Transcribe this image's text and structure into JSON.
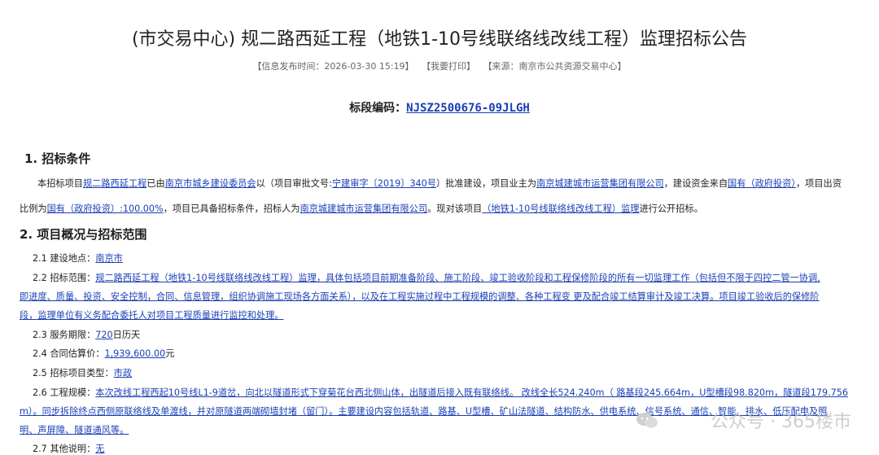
{
  "title": "(市交易中心) 规二路西延工程（地铁1-10号线联络线改线工程）监理招标公告",
  "meta": {
    "publish": "【信息发布时间：2026-03-30 15:19】",
    "print": "【我要打印】",
    "source": "【来源：南京市公共资源交易中心】"
  },
  "code_label": "标段编码：",
  "code_value": "NJSZ2500676-09JLGH",
  "s1": {
    "heading": "1.  招标条件",
    "l1": [
      {
        "t": "本招标项目",
        "u": false
      },
      {
        "t": "规二路西延工程",
        "u": true
      },
      {
        "t": "已由",
        "u": false
      },
      {
        "t": "南京市城乡建设委员会",
        "u": true
      },
      {
        "t": "以（项目审批文号:",
        "u": false
      },
      {
        "t": "宁建审字〔2019〕340号",
        "u": true
      },
      {
        "t": "）批准建设，项目业主为",
        "u": false
      },
      {
        "t": "南京城建城市运营集团有限公司",
        "u": true
      },
      {
        "t": "，建设资金来自",
        "u": false
      },
      {
        "t": "国有（政府投资）",
        "u": true
      },
      {
        "t": "，项目出资",
        "u": false
      }
    ],
    "l2": [
      {
        "t": "比例为",
        "u": false
      },
      {
        "t": "国有（政府投资）:100.00%",
        "u": true
      },
      {
        "t": "，项目已具备招标条件，招标人为",
        "u": false
      },
      {
        "t": "南京城建城市运营集团有限公司",
        "u": true
      },
      {
        "t": "。现对该项目",
        "u": false
      },
      {
        "t": "（地铁1-10号线联络线改线工程）监理",
        "u": true
      },
      {
        "t": "进行公开招标。",
        "u": false
      }
    ]
  },
  "s2": {
    "heading": "2.  项目概况与招标范围",
    "i21_label": "2.1 建设地点：",
    "i21_value": "南京市",
    "i22_label": "2.2 招标范围：",
    "i22_l1": "规二路西延工程（地铁1-10号线联络线改线工程）监理，具体包括项目前期准备阶段、施工阶段、竣工验收阶段和工程保修阶段的所有一切监理工作（包括但不限于四控二管一协调,",
    "i22_l2": "即进度、质量、投资、安全控制，合同、信息管理，组织协调施工现场各方面关系），以及在工程实施过程中工程规模的调整、各种工程变   更及配合竣工结算审计及竣工决算。项目竣工验收后的保修阶",
    "i22_l3": "段，监理单位有义务配合委托人对项目工程质量进行监控和处理。",
    "i23_label": "2.3 服务期限：",
    "i23_value": "720",
    "i23_suffix": "日历天",
    "i24_label": "2.4 合同估算价：",
    "i24_value": "1,939,600.00",
    "i24_suffix": "元",
    "i25_label": "2.5 招标项目类型：",
    "i25_value": "市政",
    "i26_label": "2.6 工程规模：",
    "i26_l1": "本次改线工程西起10号线L1-9道岔，向北以隧道形式下穿菊花台西北侧山体，出隧道后接入既有联络线。   改线全长524.240m（   路基段245.664m，U型槽段98.820m，隧道段179.756",
    "i26_l2": "m）。同步拆除终点西侧原联络线及单渡线，并对原隧道两端砌墙封堵（留门）。主要建设内容包括轨道、路基、U型槽、矿山法隧道、结构防水、供电系统、信号系统、通信、智能、排水、低压配电及照",
    "i26_l3": "明、声屏障、隧道通风等。",
    "i27_label": "2.7 其他说明：",
    "i27_value": "无"
  },
  "watermark": "公众号 · 365楼市",
  "link_color": "#1a3fb5"
}
